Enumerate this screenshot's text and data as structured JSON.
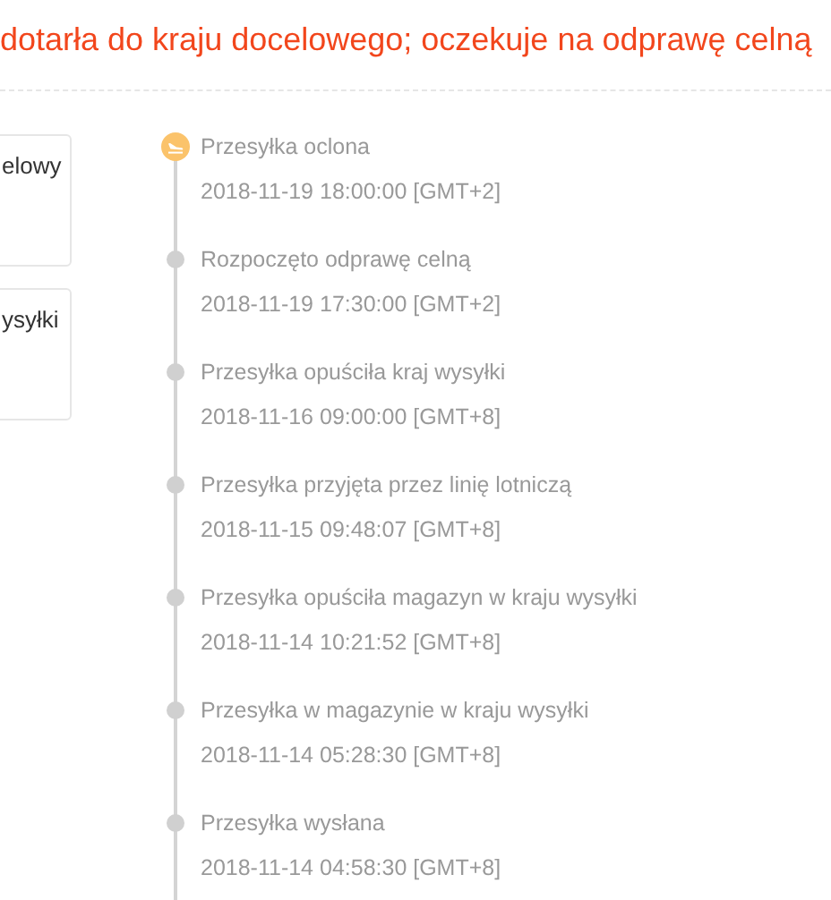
{
  "status_headline": "dotarła do kraju docelowego; oczekuje na odprawę celną",
  "side_cards": [
    {
      "text": "elowy"
    },
    {
      "text": "ysyłki"
    }
  ],
  "timeline": [
    {
      "title": "Przesyłka oclona",
      "time": "2018-11-19 18:00:00 [GMT+2]",
      "current": true
    },
    {
      "title": "Rozpoczęto odprawę celną",
      "time": "2018-11-19 17:30:00 [GMT+2]",
      "current": false
    },
    {
      "title": "Przesyłka opuściła kraj wysyłki",
      "time": "2018-11-16 09:00:00 [GMT+8]",
      "current": false
    },
    {
      "title": "Przesyłka przyjęta przez linię lotniczą",
      "time": "2018-11-15 09:48:07 [GMT+8]",
      "current": false
    },
    {
      "title": "Przesyłka opuściła magazyn w kraju wysyłki",
      "time": "2018-11-14 10:21:52 [GMT+8]",
      "current": false
    },
    {
      "title": "Przesyłka w magazynie w kraju wysyłki",
      "time": "2018-11-14 05:28:30 [GMT+8]",
      "current": false
    },
    {
      "title": "Przesyłka wysłana",
      "time": "2018-11-14 04:58:30 [GMT+8]",
      "current": false
    }
  ]
}
